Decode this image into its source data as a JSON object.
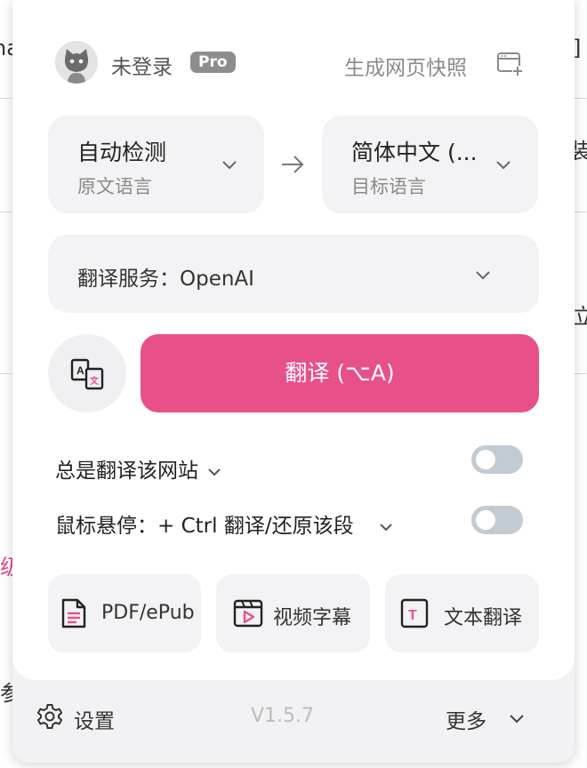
{
  "header": {
    "user_name": "未登录",
    "badge": "Pro",
    "snapshot_label": "生成网页快照"
  },
  "languages": {
    "source": {
      "value": "自动检测",
      "caption": "原文语言"
    },
    "target": {
      "value": "简体中文 (...",
      "caption": "目标语言"
    }
  },
  "service": {
    "label": "翻译服务：OpenAI"
  },
  "translate_button": {
    "label": "翻译 (⌥A)"
  },
  "toggles": [
    {
      "label": "总是翻译该网站",
      "on": false
    },
    {
      "label": "鼠标悬停：+ Ctrl 翻译/还原该段",
      "on": false
    }
  ],
  "tools": [
    {
      "label": "PDF/ePub",
      "icon": "document-icon"
    },
    {
      "label": "视频字幕",
      "icon": "video-icon"
    },
    {
      "label": "文本翻译",
      "icon": "text-icon"
    }
  ],
  "footer": {
    "settings_label": "设置",
    "version": "V1.5.7",
    "more_label": "更多"
  },
  "colors": {
    "accent": "#e8508a",
    "toggle_off": "#c2cad2",
    "panel": "#f3f3f5"
  }
}
